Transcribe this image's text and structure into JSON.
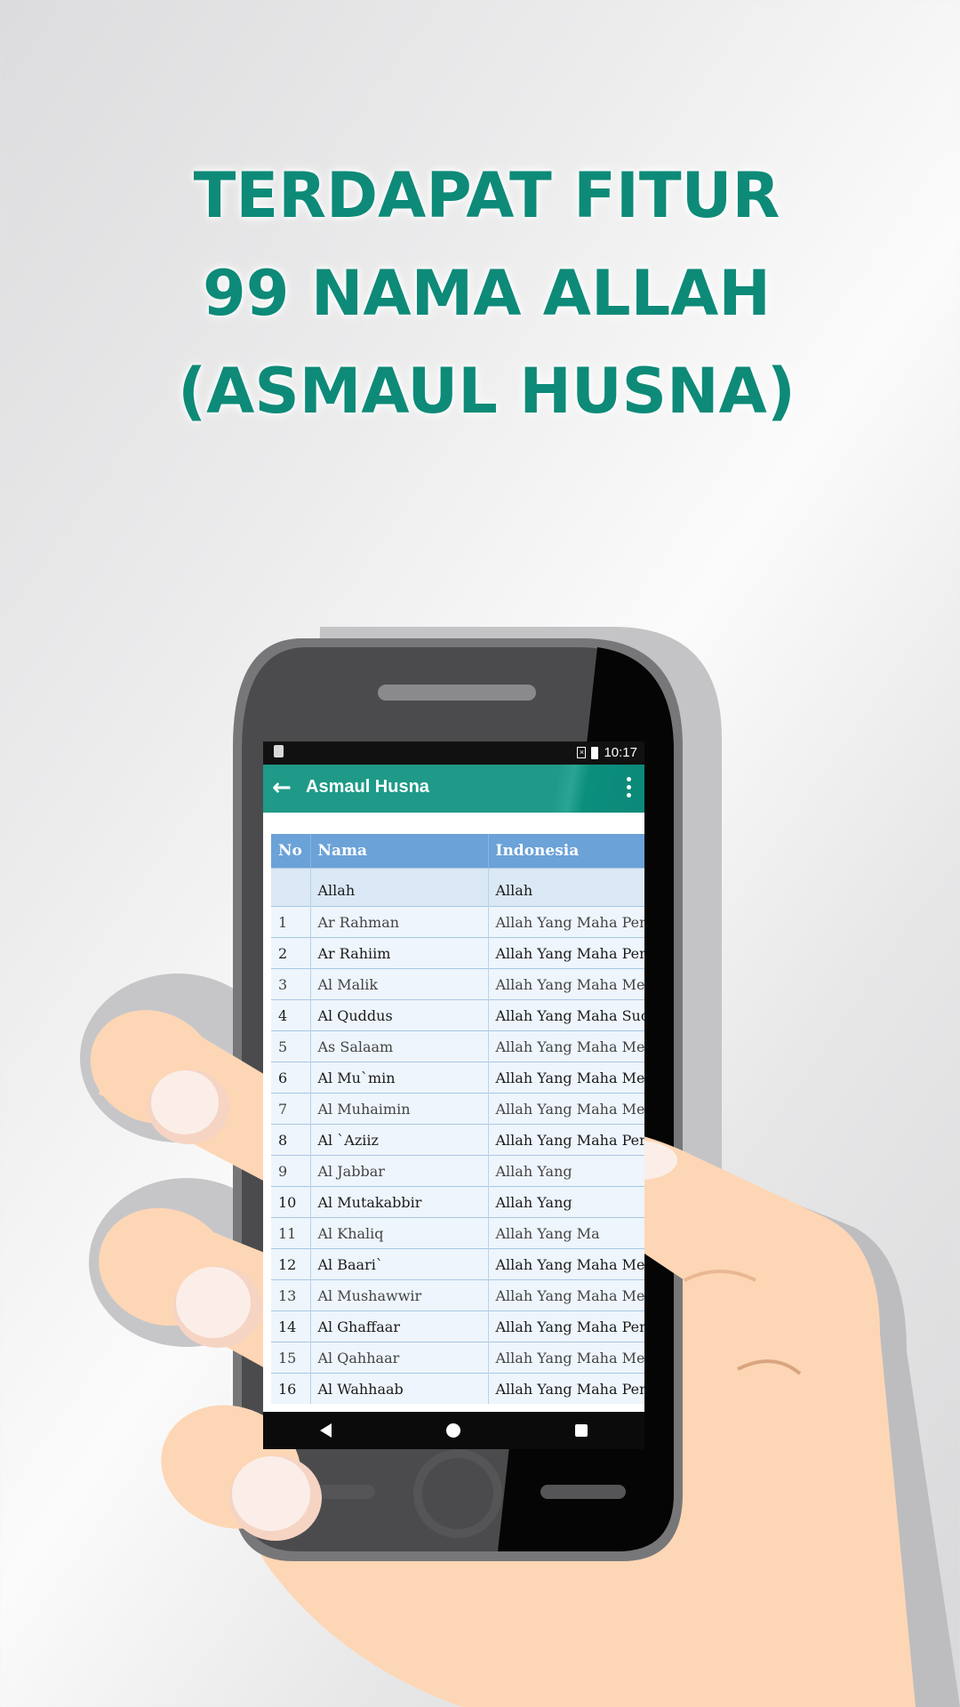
{
  "headline": {
    "line1": "TERDAPAT FITUR",
    "line2": "99 NAMA ALLAH",
    "line3": "(ASMAUL HUSNA)"
  },
  "status_bar": {
    "time": "10:17"
  },
  "app_bar": {
    "title": "Asmaul Husna",
    "back_icon": "arrow-left-icon",
    "menu_icon": "more-vertical-icon"
  },
  "table": {
    "headers": {
      "no": "No",
      "nama": "Nama",
      "indonesia": "Indonesia"
    },
    "rows": [
      {
        "no": "",
        "nama": "Allah",
        "indonesia": "Allah"
      },
      {
        "no": "1",
        "nama": "Ar Rahman",
        "indonesia": "Allah Yang Maha Pen"
      },
      {
        "no": "2",
        "nama": "Ar Rahiim",
        "indonesia": "Allah Yang Maha Pen"
      },
      {
        "no": "3",
        "nama": "Al Malik",
        "indonesia": "Allah Yang Maha Me"
      },
      {
        "no": "4",
        "nama": "Al Quddus",
        "indonesia": "Allah Yang Maha Suc"
      },
      {
        "no": "5",
        "nama": "As Salaam",
        "indonesia": "Allah Yang Maha Me"
      },
      {
        "no": "6",
        "nama": "Al Mu`min",
        "indonesia": "Allah Yang Maha Me"
      },
      {
        "no": "7",
        "nama": "Al Muhaimin",
        "indonesia": "Allah Yang Maha Me"
      },
      {
        "no": "8",
        "nama": "Al `Aziiz",
        "indonesia": "Allah Yang Maha Per"
      },
      {
        "no": "9",
        "nama": "Al Jabbar",
        "indonesia": "Allah Yang"
      },
      {
        "no": "10",
        "nama": "Al Mutakabbir",
        "indonesia": "Allah Yang"
      },
      {
        "no": "11",
        "nama": "Al Khaliq",
        "indonesia": "Allah Yang Ma"
      },
      {
        "no": "12",
        "nama": "Al Baari`",
        "indonesia": "Allah Yang Maha Me"
      },
      {
        "no": "13",
        "nama": "Al Mushawwir",
        "indonesia": "Allah Yang Maha Me"
      },
      {
        "no": "14",
        "nama": "Al Ghaffaar",
        "indonesia": "Allah Yang Maha Pen"
      },
      {
        "no": "15",
        "nama": "Al Qahhaar",
        "indonesia": "Allah Yang Maha Me"
      },
      {
        "no": "16",
        "nama": "Al Wahhaab",
        "indonesia": "Allah Yang Maha Pen"
      }
    ]
  },
  "colors": {
    "accent": "#0e8a78",
    "app_bar": "#1f9a88",
    "table_header": "#6ba2d8"
  }
}
